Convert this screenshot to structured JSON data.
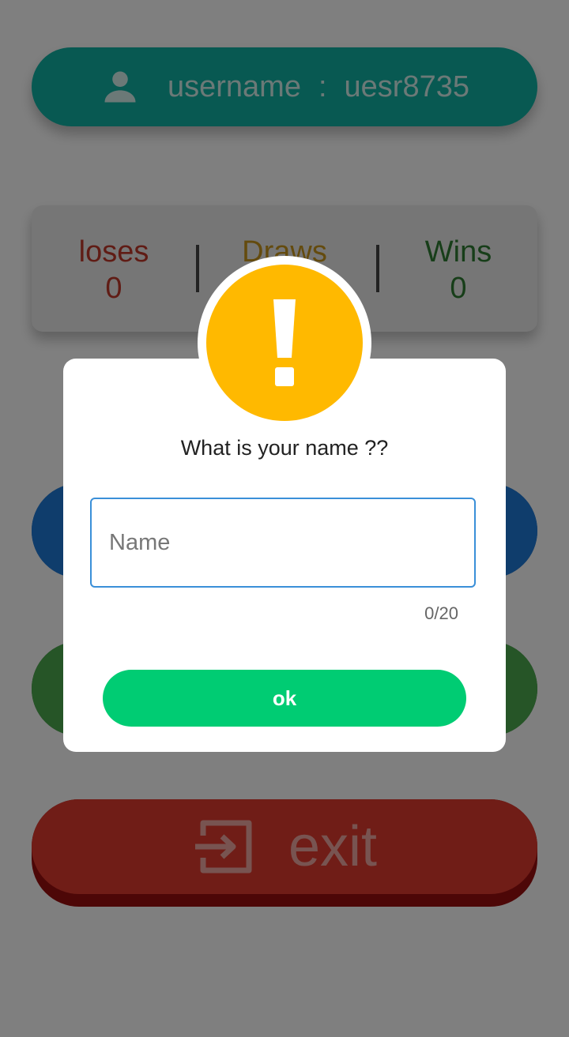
{
  "user": {
    "label": "username",
    "separator": ":",
    "value": "uesr8735"
  },
  "stats": {
    "loses_label": "loses",
    "loses_value": "0",
    "draws_label": "Draws",
    "wins_label": "Wins",
    "wins_value": "0"
  },
  "exit_button": {
    "label": "exit"
  },
  "dialog": {
    "question": "What is your name ??",
    "input_placeholder": "Name",
    "input_value": "",
    "counter": "0/20",
    "ok_label": "ok"
  },
  "colors": {
    "accent_teal": "#10b3a4",
    "warning_yellow": "#ffb900",
    "ok_green": "#00cc73",
    "input_border": "#3a8fd8"
  },
  "icons": {
    "user": "person-icon",
    "exit": "exit-icon",
    "alert": "exclamation-icon"
  }
}
